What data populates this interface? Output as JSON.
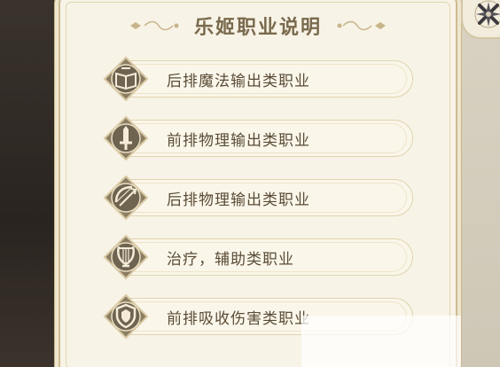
{
  "dialog": {
    "title": "乐姬职业说明",
    "close_icon": "close-x-icon"
  },
  "roles": [
    {
      "label": "后排魔法输出类职业",
      "icon": "spellbook-icon"
    },
    {
      "label": "前排物理输出类职业",
      "icon": "sword-icon"
    },
    {
      "label": "后排物理输出类职业",
      "icon": "bow-icon"
    },
    {
      "label": "治疗，辅助类职业",
      "icon": "lyre-icon"
    },
    {
      "label": "前排吸收伤害类职业",
      "icon": "shield-icon"
    }
  ],
  "colors": {
    "panel_bg": "#f7f3e6",
    "border_gold": "#cdbb92",
    "title_text": "#7a6a4d",
    "label_text": "#5a4c36",
    "badge_fill": "#8a7d63"
  }
}
